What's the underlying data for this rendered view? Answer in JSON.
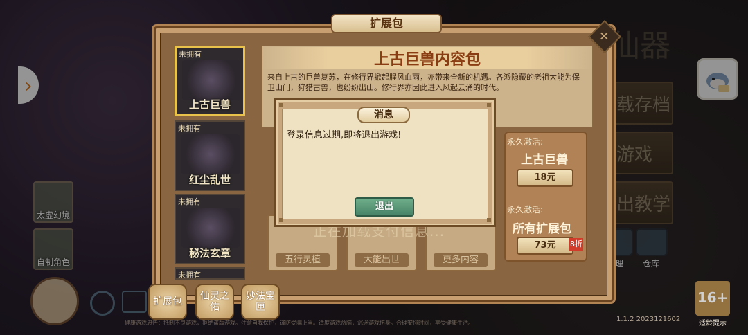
{
  "panel": {
    "title": "扩展包"
  },
  "cards": [
    {
      "tag": "未拥有",
      "name": "上古巨兽",
      "selected": true
    },
    {
      "tag": "未拥有",
      "name": "红尘乱世",
      "selected": false
    },
    {
      "tag": "未拥有",
      "name": "秘法玄章",
      "selected": false
    },
    {
      "tag": "未拥有",
      "name": "",
      "selected": false
    }
  ],
  "pack": {
    "title": "上古巨兽内容包",
    "description": "来自上古的巨兽复苏，在修行界掀起腥风血雨，亦带来全新的机遇。各派隐藏的老祖大能为保卫山门，狩猎古兽，也纷纷出山。修行界亦因此进入风起云涌的时代。"
  },
  "contents": [
    "五行灵植",
    "大能出世",
    "更多内容"
  ],
  "purchase": {
    "single_label": "永久激活:",
    "single_name": "上古巨兽",
    "single_price": "18元",
    "all_label": "永久激活:",
    "all_name": "所有扩展包",
    "all_price": "73元",
    "all_discount": "8折"
  },
  "loading_text": "正在加载支付信息...",
  "right_menu": [
    "载存档",
    "游戏",
    "出教学"
  ],
  "side_items": [
    "太虚幻境",
    "自制角色"
  ],
  "bottom_buttons": [
    "扩展包",
    "仙灵之佑",
    "妙法宝匣"
  ],
  "right_small": [
    "管理",
    "仓库"
  ],
  "dialog": {
    "title": "消息",
    "message": "登录信息过期,即将退出游戏!",
    "button": "退出"
  },
  "footer_text": "健康游戏忠告：抵制不良游戏，拒绝盗版游戏。注意自我保护，谨防受骗上当。适度游戏益脑，沉迷游戏伤身。合理安排时间，享受健康生活。",
  "version": "1.1.2 2023121602",
  "age_rating": "16+",
  "age_text": "适龄提示",
  "colors": {
    "accent": "#e8c24a",
    "exit_button": "#478468",
    "panel": "#c79f71"
  }
}
